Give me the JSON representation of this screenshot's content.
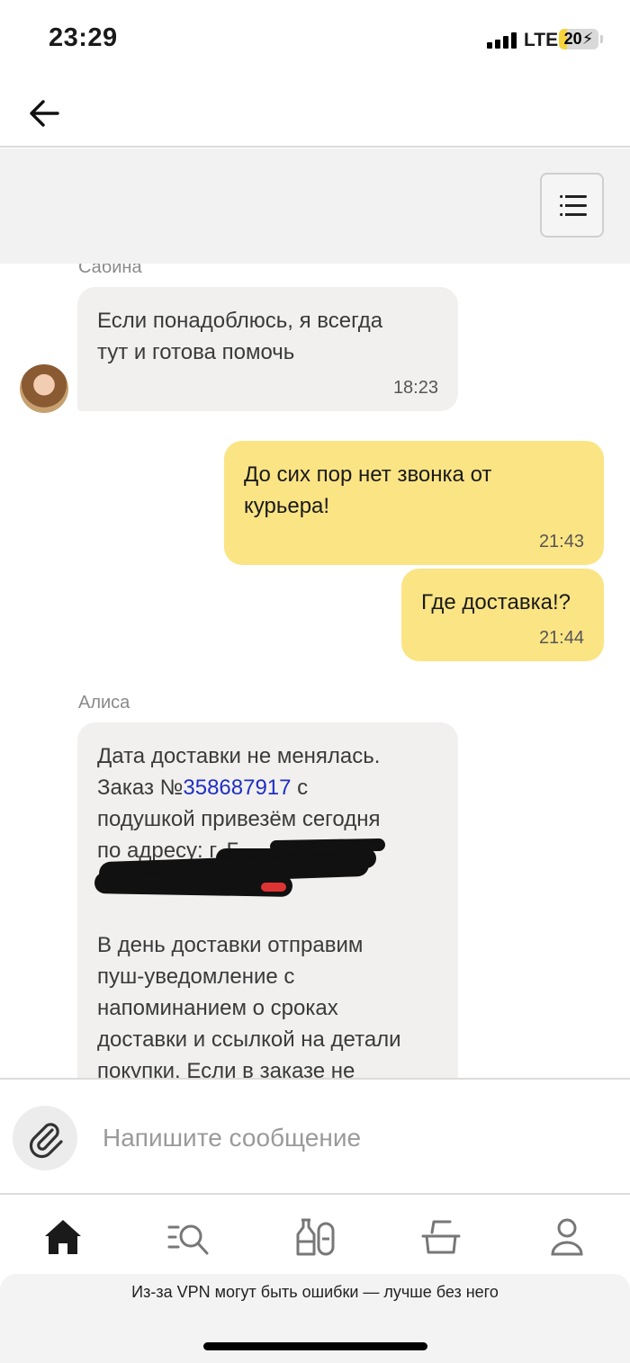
{
  "status_bar": {
    "time": "23:29",
    "network": "LTE",
    "battery": "20",
    "battery_level": 0.2,
    "signal_bars": 4
  },
  "nav": {
    "back_icon": "arrow-left-icon"
  },
  "toolbar": {
    "menu_icon": "list-menu-icon"
  },
  "messages": [
    {
      "sender": "Сабина",
      "direction": "incoming",
      "lines": [
        "Если понадоблюсь, я всегда",
        "тут и готова помочь"
      ],
      "time": "18:23",
      "avatar": "operator-avatar"
    },
    {
      "direction": "outgoing",
      "lines": [
        "До сих пор нет звонка от",
        "курьера!"
      ],
      "time": "21:43"
    },
    {
      "direction": "outgoing",
      "lines": [
        "Где доставка!?"
      ],
      "time": "21:44"
    },
    {
      "sender": "Алиса",
      "direction": "incoming",
      "line1": "Дата доставки не менялась.",
      "line2_prefix": "Заказ №",
      "order_number": "358687917",
      "line2_suffix": " с",
      "line3": "подушкой привезём сегодня",
      "line4": "по адресу: г. Г",
      "paragraph2": [
        "В день доставки отправим",
        "пуш-уведомление с",
        "напоминанием о сроках",
        "доставки и ссылкой на детали",
        "покупки. Если в заказе не"
      ]
    }
  ],
  "composer": {
    "placeholder": "Напишите сообщение",
    "attach_icon": "paperclip-icon"
  },
  "tabs": [
    {
      "name": "home",
      "icon": "home-icon",
      "active": true
    },
    {
      "name": "catalog",
      "icon": "catalog-search-icon",
      "active": false
    },
    {
      "name": "products",
      "icon": "bottles-icon",
      "active": false
    },
    {
      "name": "cart",
      "icon": "basket-icon",
      "active": false
    },
    {
      "name": "profile",
      "icon": "profile-icon",
      "active": false
    }
  ],
  "banner": {
    "text": "Из-за VPN могут быть ошибки — лучше без него"
  },
  "colors": {
    "outgoing_bubble": "#fbe484",
    "incoming_bubble": "#f1f0ee",
    "link": "#1f2fc4",
    "battery_accent": "#f6d33a"
  }
}
